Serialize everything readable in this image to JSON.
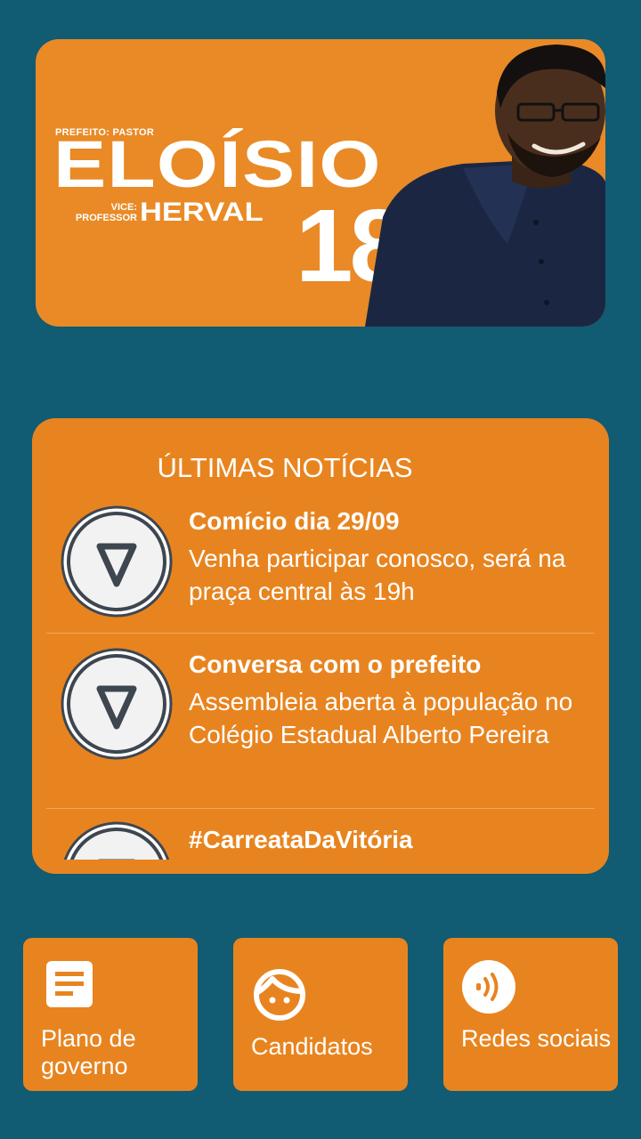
{
  "banner": {
    "prefeito_label": "PREFEITO: PASTOR",
    "candidate_name": "ELOÍSIO",
    "vice_label_line1": "VICE:",
    "vice_label_line2": "PROFESSOR",
    "vice_name": "HERVAL",
    "candidate_number": "18"
  },
  "news": {
    "title": "ÚLTIMAS NOTÍCIAS",
    "items": [
      {
        "heading": "Comício dia 29/09",
        "body": "Venha participar conosco, será na praça central às 19h",
        "icon": "v-logo-icon"
      },
      {
        "heading": "Conversa com o prefeito",
        "body": "Assembleia aberta à população no Colégio Estadual Alberto Pereira",
        "icon": "v-logo-icon"
      },
      {
        "heading": "#CarreataDaVitória",
        "body": "",
        "icon": "v-logo-icon"
      }
    ]
  },
  "tiles": [
    {
      "label": "Plano de governo",
      "icon": "document-icon"
    },
    {
      "label": "Candidatos",
      "icon": "face-icon"
    },
    {
      "label": "Redes sociais",
      "icon": "broadcast-icon"
    }
  ],
  "colors": {
    "background": "#115b73",
    "accent_orange": "#e8841f",
    "text": "#ffffff"
  }
}
